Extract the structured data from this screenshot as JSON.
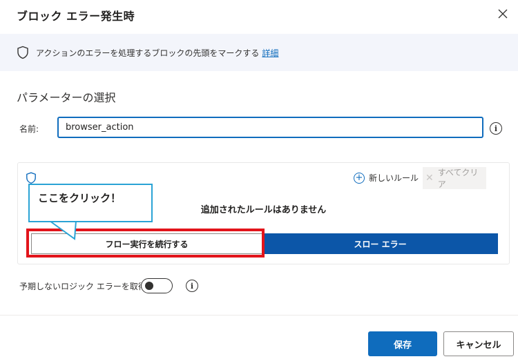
{
  "dialog": {
    "title": "ブロック エラー発生時",
    "close_icon": "close-icon"
  },
  "info_bar": {
    "icon": "shield-icon",
    "text": "アクションのエラーを処理するブロックの先頭をマークする",
    "link_label": "詳細"
  },
  "parameters": {
    "section_title": "パラメーターの選択",
    "name_label": "名前:",
    "name_value": "browser_action",
    "info_icon": "info-icon"
  },
  "rules": {
    "panel_icon": "shield-icon",
    "add_rule_label": "新しいルール",
    "clear_all_label": "すべてクリア",
    "empty_message": "追加されたルールはありません",
    "options": [
      "フロー実行を続行する",
      "スロー エラー"
    ],
    "selected_option": "スロー エラー"
  },
  "annotation": {
    "callout_text": "ここをクリック！",
    "highlight_color": "#e2141b",
    "callout_border_color": "#2aa3d5"
  },
  "logic_error": {
    "label": "予期しないロジック エラーを取得",
    "enabled": false
  },
  "footer": {
    "save_label": "保存",
    "cancel_label": "キャンセル"
  },
  "colors": {
    "accent": "#0f6cbd",
    "selected_segment": "#0c56a8",
    "info_bar_bg": "#f3f5fb"
  }
}
